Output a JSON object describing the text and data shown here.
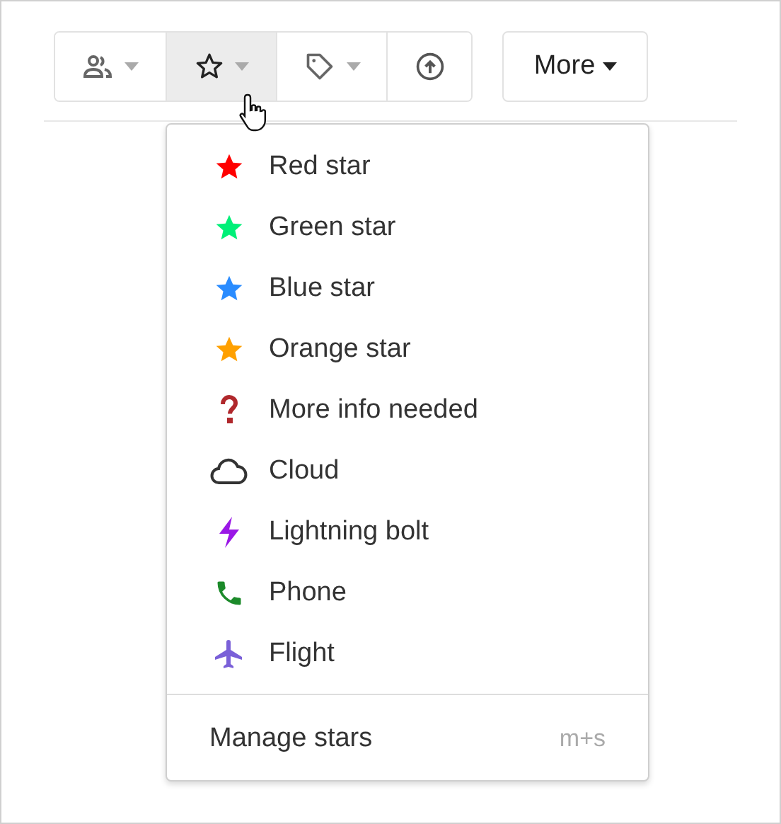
{
  "toolbar": {
    "buttons": [
      {
        "kind": "people",
        "caret": true,
        "selected": false
      },
      {
        "kind": "star",
        "caret": true,
        "selected": true
      },
      {
        "kind": "tag",
        "caret": true,
        "selected": false
      },
      {
        "kind": "upload",
        "caret": false,
        "selected": false
      }
    ],
    "more": {
      "label": "More"
    }
  },
  "menu": {
    "items": [
      {
        "kind": "star",
        "label": "Red star",
        "color": "#ff0000"
      },
      {
        "kind": "star",
        "label": "Green star",
        "color": "#00f078"
      },
      {
        "kind": "star",
        "label": "Blue star",
        "color": "#2a8cff"
      },
      {
        "kind": "star",
        "label": "Orange star",
        "color": "#ffa000"
      },
      {
        "kind": "question",
        "label": "More info needed",
        "color": "#b0282c"
      },
      {
        "kind": "cloud",
        "label": "Cloud",
        "color": "#333333"
      },
      {
        "kind": "bolt",
        "label": "Lightning bolt",
        "color": "#9a17e6"
      },
      {
        "kind": "phone",
        "label": "Phone",
        "color": "#1c8a2a"
      },
      {
        "kind": "plane",
        "label": "Flight",
        "color": "#7a60d8"
      }
    ],
    "footer": {
      "label": "Manage stars",
      "shortcut": "m+s"
    }
  }
}
